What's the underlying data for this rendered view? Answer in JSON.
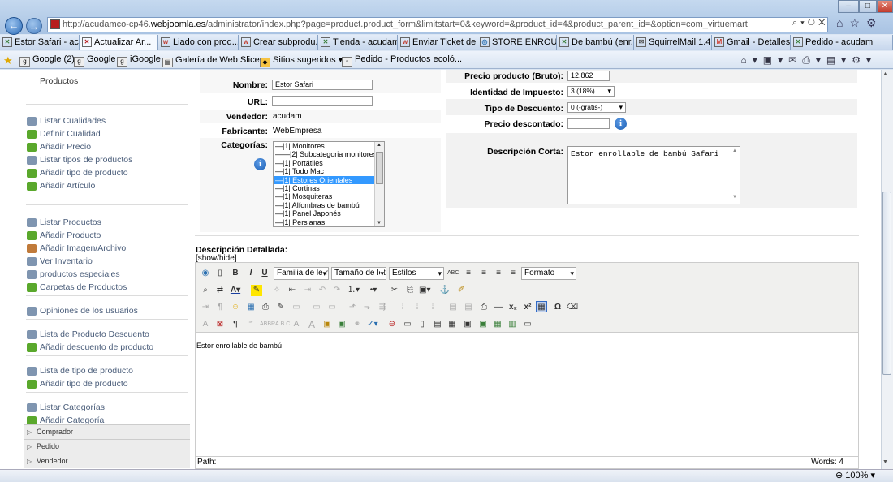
{
  "browser": {
    "url_prefix": "http://acudamco-cp46.",
    "url_domain": "webjoomla.es",
    "url_path": "/administrator/index.php?page=product.product_form&limitstart=0&keyword=&product_id=4&product_parent_id=&option=com_virtuemart",
    "tabs": [
      {
        "label": "Estor Safari - ac...",
        "icon": "joomla-icon",
        "color": "#3a7f3a"
      },
      {
        "label": "Actualizar Ar...",
        "icon": "joomla-icon",
        "color": "#b71c1c",
        "active": true
      },
      {
        "label": "Liado con prod...",
        "icon": "webempresa-icon",
        "color": "#c0392b"
      },
      {
        "label": "Crear subprodu...",
        "icon": "webempresa-icon",
        "color": "#c0392b"
      },
      {
        "label": "Tienda - acudam",
        "icon": "joomla-icon",
        "color": "#3a7f3a"
      },
      {
        "label": "Enviar Ticket de...",
        "icon": "webempresa-icon",
        "color": "#c0392b"
      },
      {
        "label": "STORE ENROUL...",
        "icon": "globe-icon",
        "color": "#2a6fb0"
      },
      {
        "label": "De bambú (enr...",
        "icon": "joomla-icon",
        "color": "#3a7f3a"
      },
      {
        "label": "SquirrelMail 1.4.2",
        "icon": "squirrel-icon",
        "color": "#555555"
      },
      {
        "label": "Gmail - Detalles...",
        "icon": "gmail-icon",
        "color": "#d23f31"
      },
      {
        "label": "Pedido - acudam",
        "icon": "joomla-icon",
        "color": "#3a7f3a"
      }
    ],
    "favorites": [
      "Google (2)",
      "Google",
      "iGoogle",
      "Galería de Web Slice ▾",
      "Sitios sugeridos ▾",
      "Pedido - Productos ecoló..."
    ],
    "zoom": "100%"
  },
  "sidebar": {
    "top_item": "Productos",
    "items": [
      {
        "label": "Listar Cualidades",
        "icon": "list-icon",
        "color": "#7f95b0"
      },
      {
        "label": "Definir Cualidad",
        "icon": "add-icon",
        "color": "#5aa82c"
      },
      {
        "label": "Añadir Precio",
        "icon": "add-icon",
        "color": "#5aa82c"
      },
      {
        "label": "Listar tipos de productos",
        "icon": "list-icon",
        "color": "#7f95b0"
      },
      {
        "label": "Añadir tipo de producto",
        "icon": "add-icon",
        "color": "#5aa82c"
      },
      {
        "label": "Añadir Artículo",
        "icon": "add-icon",
        "color": "#5aa82c"
      },
      {
        "label": "Listar Productos",
        "icon": "list-icon",
        "color": "#7f95b0"
      },
      {
        "label": "Añadir Producto",
        "icon": "add-icon",
        "color": "#5aa82c"
      },
      {
        "label": "Añadir Imagen/Archivo",
        "icon": "image-icon",
        "color": "#c07a3a"
      },
      {
        "label": "Ver Inventario",
        "icon": "inventory-icon",
        "color": "#7f95b0"
      },
      {
        "label": "productos especiales",
        "icon": "list-icon",
        "color": "#7f95b0"
      },
      {
        "label": "Carpetas de Productos",
        "icon": "add-icon",
        "color": "#5aa82c"
      },
      {
        "label": "Opiniones de los usuarios",
        "icon": "list-icon",
        "color": "#7f95b0"
      },
      {
        "label": "Lista de Producto Descuento",
        "icon": "list-icon",
        "color": "#7f95b0"
      },
      {
        "label": "Añadir descuento de producto",
        "icon": "add-icon",
        "color": "#5aa82c"
      },
      {
        "label": "Lista de tipo de producto",
        "icon": "list-icon",
        "color": "#7f95b0"
      },
      {
        "label": "Añadir tipo de producto",
        "icon": "add-icon",
        "color": "#5aa82c"
      },
      {
        "label": "Listar Categorías",
        "icon": "list-icon",
        "color": "#7f95b0"
      },
      {
        "label": "Añadir Categoría",
        "icon": "add-icon",
        "color": "#5aa82c"
      }
    ],
    "groups": [
      "Comprador",
      "Pedido",
      "Vendedor"
    ]
  },
  "form": {
    "nombre_label": "Nombre:",
    "nombre_value": "Estor Safari",
    "url_label": "URL:",
    "url_value": "",
    "vendedor_label": "Vendedor:",
    "vendedor_value": "acudam",
    "fabricante_label": "Fabricante:",
    "fabricante_value": "WebEmpresa",
    "categorias_label": "Categorías:",
    "categories": [
      "—|1| Monitores",
      "——|2| Subcategoria monitores",
      "—|1| Portátiles",
      "—|1| Todo Mac",
      "—|1| Estores Orientales",
      "—|1| Cortinas",
      "—|1| Mosquiteras",
      "—|1| Alfombras de bambú",
      "—|1| Panel Japonés",
      "—|1| Persianas"
    ],
    "selected_category_index": 4,
    "precio_label": "Precio producto (Bruto):",
    "precio_value": "12.862",
    "impuesto_label": "Identidad de Impuesto:",
    "impuesto_value": "3 (18%)",
    "tipo_descuento_label": "Tipo de Descuento:",
    "tipo_descuento_value": "0 (-gratis-)",
    "precio_descontado_label": "Precio descontado:",
    "precio_descontado_value": "",
    "desc_corta_label": "Descripción Corta:",
    "desc_corta_value": "Estor enrollable de bambú Safari",
    "desc_detallada_label": "Descripción Detallada:",
    "show_hide": "[show/hide]"
  },
  "editor": {
    "font_family": "Familia de letra",
    "font_size": "Tamaño de letra",
    "styles": "Estilos",
    "format": "Formato",
    "content": "Estor enrollable de bambú",
    "path_label": "Path:",
    "word_count": "Words: 4"
  }
}
